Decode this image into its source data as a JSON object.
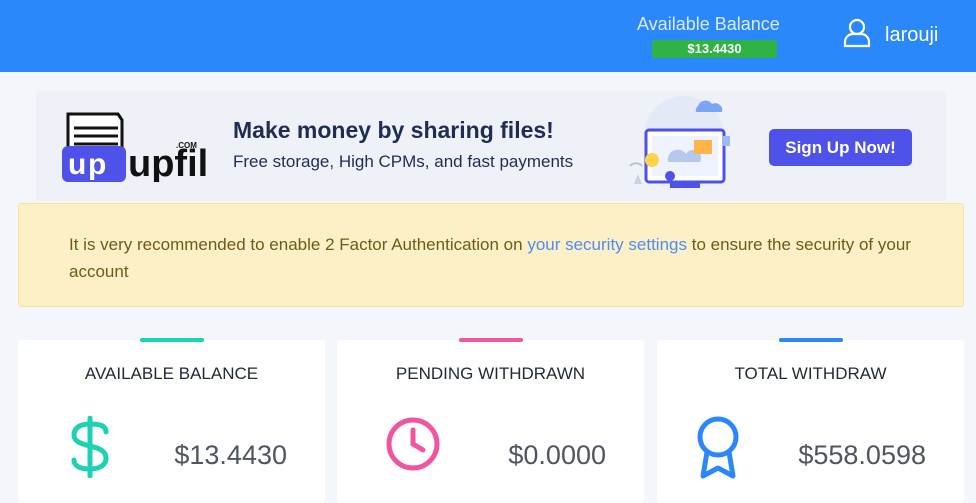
{
  "header": {
    "balance_label": "Available Balance",
    "balance_value": "$13.4430",
    "username": "larouji"
  },
  "banner": {
    "logo_text": "upfiles",
    "logo_com": ".COM",
    "title": "Make money by sharing files!",
    "subtitle": "Free storage, High CPMs, and fast payments",
    "cta": "Sign Up Now!"
  },
  "alert": {
    "text_before": "It is very recommended to enable 2 Factor Authentication on ",
    "link": "your security settings",
    "text_after": " to ensure the security of your account"
  },
  "cards": [
    {
      "title": "AVAILABLE BALANCE",
      "value": "$13.4430",
      "icon": "dollar-icon",
      "accent": "#1fd1b3"
    },
    {
      "title": "PENDING WITHDRAWN",
      "value": "$0.0000",
      "icon": "clock-icon",
      "accent": "#f2559f"
    },
    {
      "title": "TOTAL WITHDRAW",
      "value": "$558.0598",
      "icon": "award-icon",
      "accent": "#2a88fb"
    }
  ],
  "colors": {
    "topbar": "#2a88fb",
    "badge": "#2fb344",
    "cta": "#4f52e8",
    "alert_bg": "#fdf0c6"
  }
}
